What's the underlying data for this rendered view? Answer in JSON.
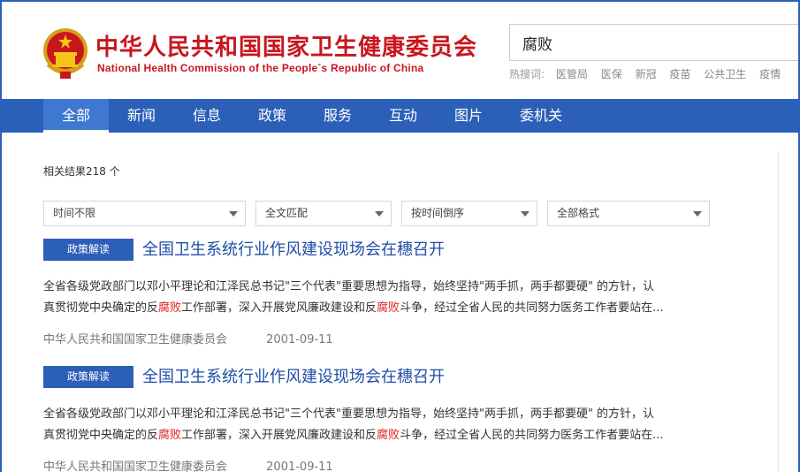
{
  "header": {
    "title_cn": "中华人民共和国国家卫生健康委员会",
    "title_en": "National Health Commission of the People´s Republic of China"
  },
  "search": {
    "value": "腐败",
    "hot_label": "热搜词:",
    "hot_words": [
      "医管局",
      "医保",
      "新冠",
      "疫苗",
      "公共卫生",
      "疫情"
    ]
  },
  "nav": {
    "items": [
      "全部",
      "新闻",
      "信息",
      "政策",
      "服务",
      "互动",
      "图片",
      "委机关"
    ],
    "active": "全部"
  },
  "results_count": "相关结果218 个",
  "filters": [
    "时间不限",
    "全文匹配",
    "按时间倒序",
    "全部格式"
  ],
  "results": [
    {
      "badge": "政策解读",
      "title": "全国卫生系统行业作风建设现场会在穗召开",
      "line1": "全省各级党政部门以邓小平理论和江泽民总书记\"三个代表\"重要思想为指导，始终坚持\"两手抓，两手都要硬\" 的方针，认",
      "line2_a": "真贯彻党中央确定的反",
      "line2_hl1": "腐败",
      "line2_b": "工作部署，深入开展党风廉政建设和反",
      "line2_hl2": "腐败",
      "line2_c": "斗争，经过全省人民的共同努力医务工作者要站在...",
      "source": "中华人民共和国国家卫生健康委员会",
      "date": "2001-09-11"
    },
    {
      "badge": "政策解读",
      "title": "全国卫生系统行业作风建设现场会在穗召开",
      "line1": "全省各级党政部门以邓小平理论和江泽民总书记\"三个代表\"重要思想为指导，始终坚持\"两手抓，两手都要硬\" 的方针，认",
      "line2_a": "真贯彻党中央确定的反",
      "line2_hl1": "腐败",
      "line2_b": "工作部署，深入开展党风廉政建设和反",
      "line2_hl2": "腐败",
      "line2_c": "斗争，经过全省人民的共同努力医务工作者要站在...",
      "source": "中华人民共和国国家卫生健康委员会",
      "date": "2001-09-11"
    }
  ],
  "colors": {
    "brand_red": "#c8161d",
    "nav_blue": "#2b5fb8",
    "link_blue": "#1f4ea8",
    "highlight_red": "#e0201b"
  },
  "icons": {
    "emblem": "national-emblem-icon",
    "dropdown": "chevron-down-icon"
  }
}
